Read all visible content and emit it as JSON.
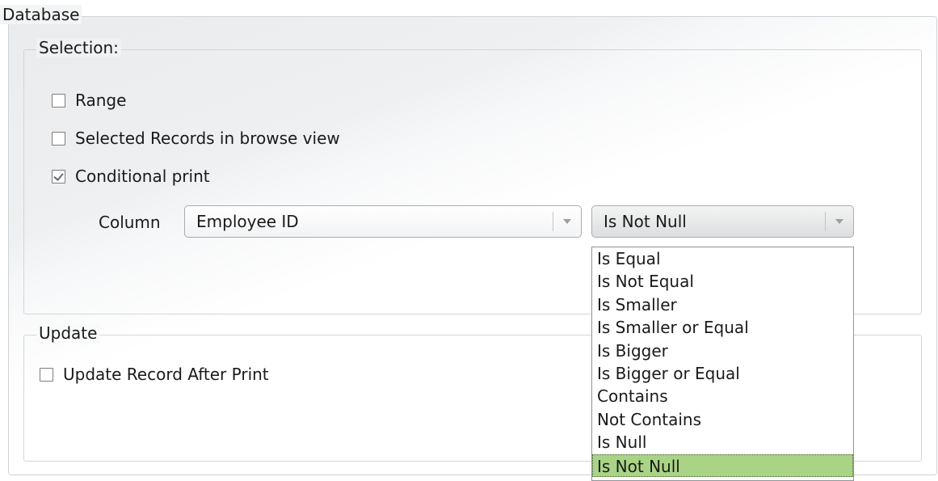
{
  "database_group": {
    "title": "Database"
  },
  "selection_group": {
    "title": "Selection:",
    "options": [
      {
        "label": "Range",
        "checked": false
      },
      {
        "label": "Selected Records in browse view",
        "checked": false
      },
      {
        "label": "Conditional print",
        "checked": true
      }
    ],
    "column_label": "Column",
    "column_value": "Employee ID",
    "condition_value": "Is Not Null",
    "condition_options": [
      "Is Equal",
      "Is Not Equal",
      "Is Smaller",
      "Is Smaller or Equal",
      "Is Bigger",
      "Is Bigger or Equal",
      "Contains",
      "Not Contains",
      "Is Null",
      "Is Not Null"
    ],
    "selected_option_index": 9
  },
  "update_group": {
    "title": "Update",
    "option": {
      "label": "Update Record After Print",
      "checked": false
    }
  },
  "colors": {
    "selected_highlight": "#a9d486",
    "border": "#d2d6d9"
  },
  "icons": {
    "dropdown_arrow": "chevron-down-icon"
  }
}
